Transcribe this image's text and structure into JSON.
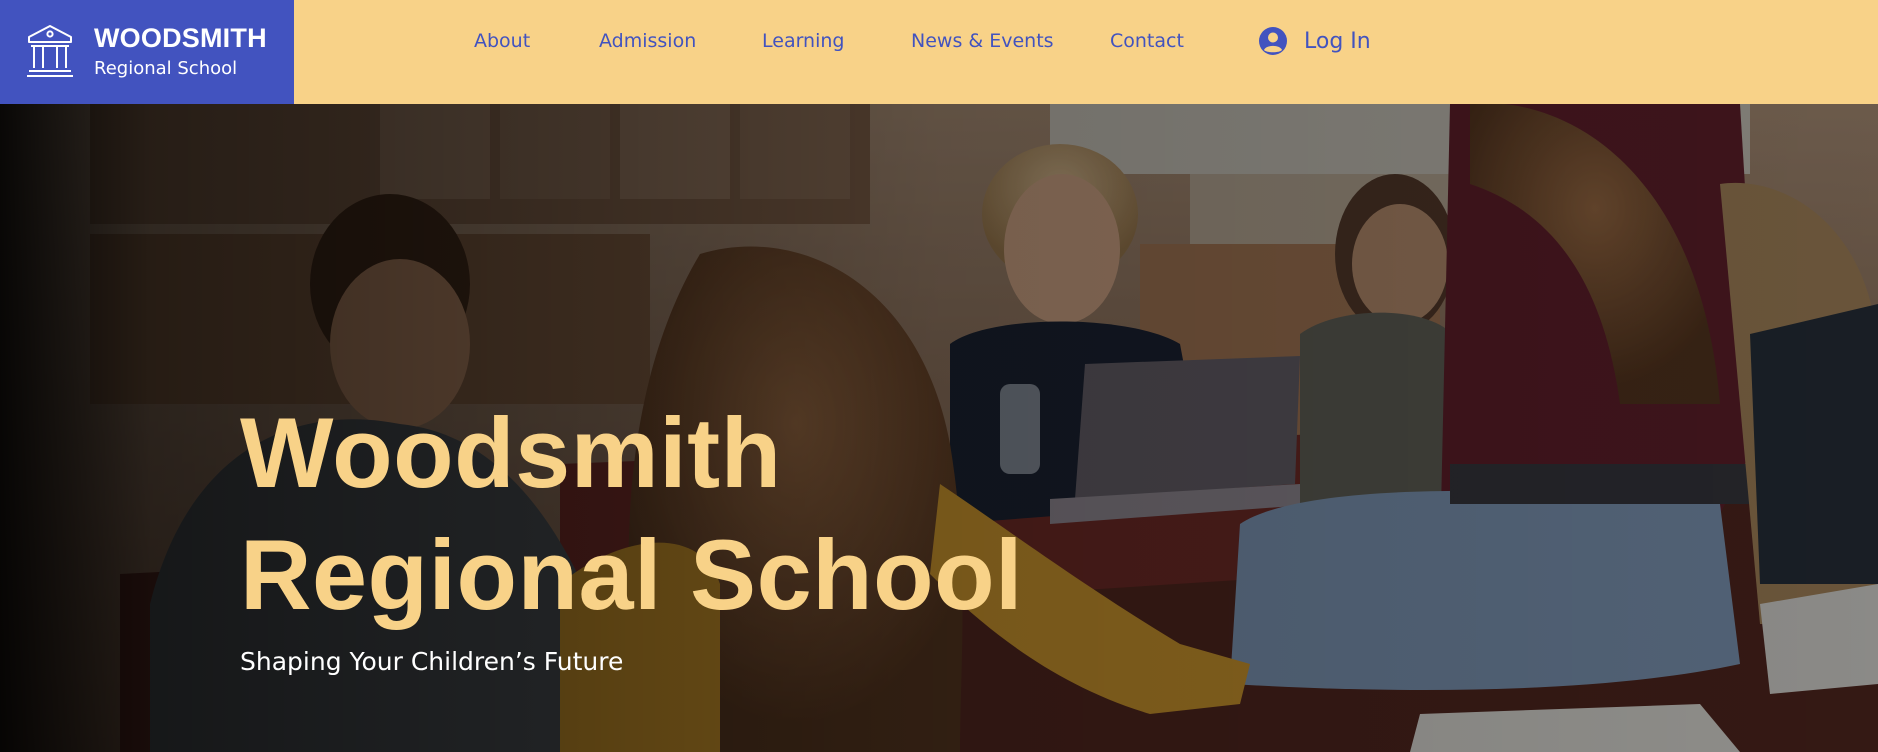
{
  "brand": {
    "name": "WOODSMITH",
    "subtitle": "Regional School",
    "icon": "school-building-icon"
  },
  "nav": {
    "items": [
      {
        "label": "About"
      },
      {
        "label": "Admission"
      },
      {
        "label": "Learning"
      },
      {
        "label": "News & Events"
      },
      {
        "label": "Contact"
      }
    ],
    "login": {
      "label": "Log In",
      "icon": "user-avatar-icon"
    }
  },
  "hero": {
    "title_line1": "Woodsmith",
    "title_line2": "Regional School",
    "subtitle": "Shaping Your Children’s Future",
    "image": "students-in-classroom-photo"
  },
  "colors": {
    "brand_blue": "#4253bf",
    "header_yellow": "#f8d288",
    "hero_title": "#f8d288",
    "hero_subtitle": "#ffffff"
  }
}
